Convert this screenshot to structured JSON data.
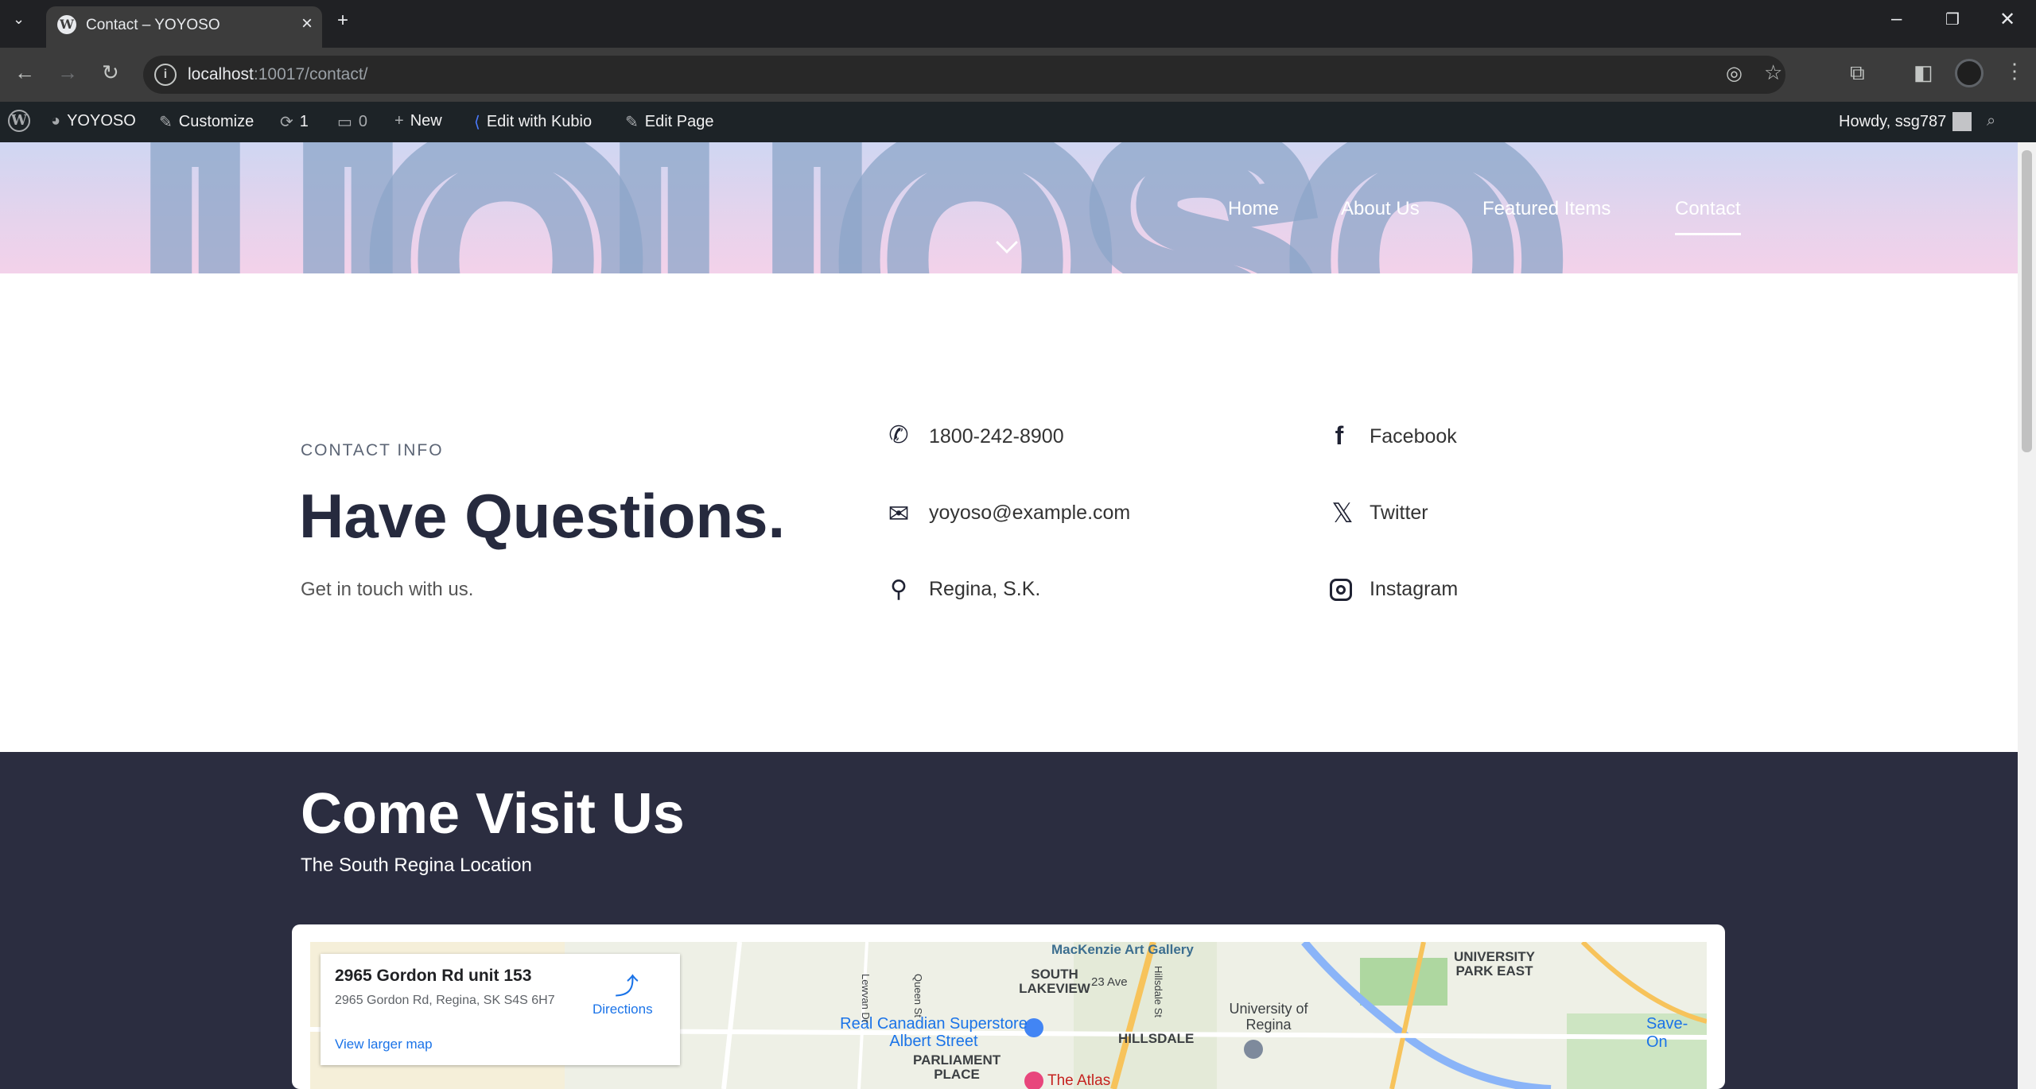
{
  "browser": {
    "tab_title": "Contact – YOYOSO",
    "url_host": "localhost",
    "url_rest": ":10017/contact/"
  },
  "adminbar": {
    "site": "YOYOSO",
    "customize": "Customize",
    "updates": "1",
    "comments": "0",
    "new": "New",
    "kubio": "Edit with Kubio",
    "edit_page": "Edit Page",
    "howdy": "Howdy, ssg787"
  },
  "nav": {
    "items": [
      {
        "label": "Home"
      },
      {
        "label": "About Us"
      },
      {
        "label": "Featured Items"
      },
      {
        "label": "Contact"
      }
    ]
  },
  "contact": {
    "eyebrow": "CONTACT INFO",
    "heading": "Have Questions.",
    "subtext": "Get in touch with us.",
    "phone": "1800-242-8900",
    "email": "yoyoso@example.com",
    "location": "Regina, S.K.",
    "facebook": "Facebook",
    "twitter": "Twitter",
    "instagram": "Instagram"
  },
  "visit": {
    "heading": "Come Visit Us",
    "subtext": "The South Regina Location"
  },
  "map": {
    "place_title": "2965 Gordon Rd unit 153",
    "place_address": "2965 Gordon Rd, Regina, SK S4S 6H7",
    "directions": "Directions",
    "larger_map": "View larger map",
    "labels": [
      "MacKenzie Art Gallery",
      "SOUTH LAKEVIEW",
      "23 Ave",
      "University of Regina",
      "UNIVERSITY PARK EAST",
      "Real Canadian Superstore Albert Street",
      "HILLSDALE",
      "PARLIAMENT PLACE",
      "The Atlas",
      "Save-On",
      "Lewvan Dr",
      "Queen St",
      "Hillsdale St"
    ]
  }
}
